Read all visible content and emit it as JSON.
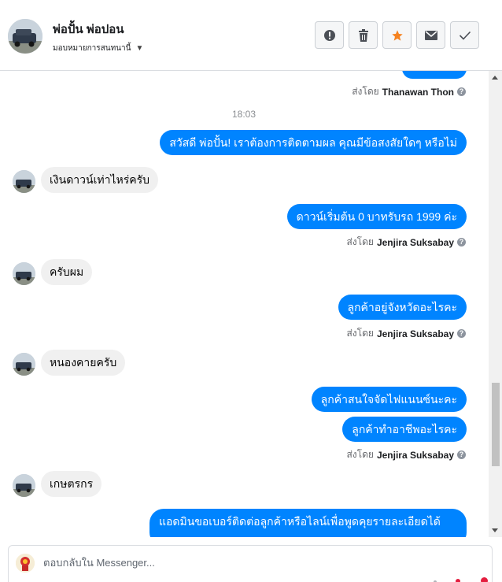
{
  "header": {
    "contact_name": "พ่อปั้น พ่อปอน",
    "assign_label": "มอบหมายการสนทนานี้",
    "actions": [
      {
        "name": "spam-button",
        "icon": "exclamation-icon"
      },
      {
        "name": "delete-button",
        "icon": "trash-icon"
      },
      {
        "name": "star-button",
        "icon": "star-icon",
        "color": "#f5821f"
      },
      {
        "name": "mark-unread-button",
        "icon": "envelope-icon"
      },
      {
        "name": "mark-done-button",
        "icon": "check-icon"
      }
    ]
  },
  "conversation": {
    "top_sent_by_prefix": "ส่งโดย",
    "top_sent_by_name": "Thanawan Thon",
    "timestamp": "18:03",
    "messages": [
      {
        "direction": "out",
        "text": "สวัสดี พ่อปั้น! เราต้องการติดตามผล คุณมีข้อสงสัยใดๆ หรือไม่"
      },
      {
        "direction": "in",
        "text": "เงินดาวน์เท่าไหร่ครับ"
      },
      {
        "direction": "out",
        "text": "ดาวน์เริ่มต้น 0 บาทรับรถ 1999 ค่ะ",
        "sent_by_prefix": "ส่งโดย",
        "sent_by_name": "Jenjira Suksabay"
      },
      {
        "direction": "in",
        "text": "ครับผม"
      },
      {
        "direction": "out",
        "text": "ลูกค้าอยู่จังหวัดอะไรคะ",
        "sent_by_prefix": "ส่งโดย",
        "sent_by_name": "Jenjira Suksabay"
      },
      {
        "direction": "in",
        "text": "หนองคายครับ"
      },
      {
        "direction": "out",
        "text": "ลูกค้าสนใจจัดไฟแนนซ์นะคะ"
      },
      {
        "direction": "out",
        "text": "ลูกค้าทำอาชีพอะไรคะ",
        "sent_by_prefix": "ส่งโดย",
        "sent_by_name": "Jenjira Suksabay"
      },
      {
        "direction": "in",
        "text": "เกษตรกร"
      },
      {
        "direction": "out",
        "text": "แอดมินขอเบอร์ติดต่อลูกค้าหรือไลน์เพื่อพูดคุยรายละเอียดได้ไหมคะ"
      }
    ]
  },
  "reply": {
    "placeholder": "ตอบกลับใน Messenger..."
  },
  "colors": {
    "outgoing_bubble": "#0084ff",
    "incoming_bubble": "#f0f0f0",
    "star_accent": "#f5821f"
  }
}
